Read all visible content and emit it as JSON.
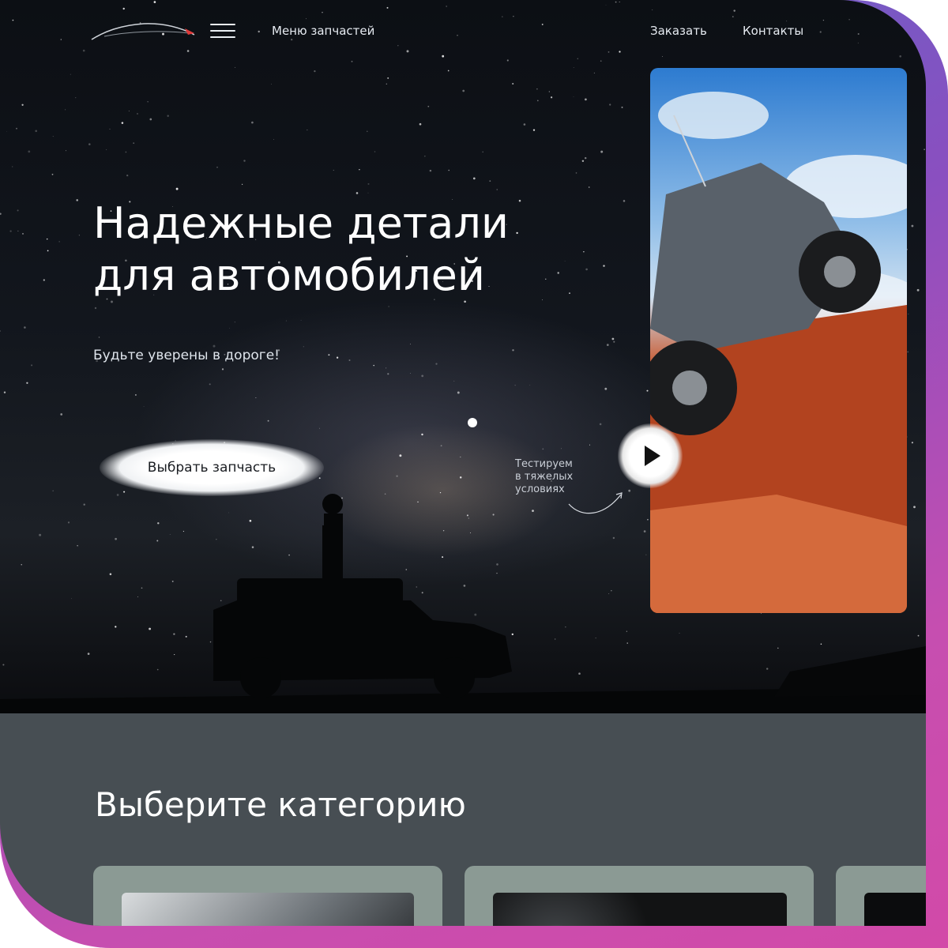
{
  "nav": {
    "menu_label": "Меню запчастей",
    "order_label": "Заказать",
    "contacts_label": "Контакты"
  },
  "hero": {
    "title_line1": "Надежные детали",
    "title_line2": "для автомобилей",
    "subtitle": "Будьте уверены в дороге!",
    "cta_label": "Выбрать запчасть",
    "note_line1": "Тестируем",
    "note_line2": "в тяжелых",
    "note_line3": "условиях"
  },
  "categories": {
    "title": "Выберите категорию"
  },
  "icons": {
    "logo": "car-logo-icon",
    "menu": "hamburger-menu-icon",
    "play": "play-icon",
    "arrow": "curved-arrow-icon"
  },
  "colors": {
    "accent_line": "#3b82d6",
    "section_bg": "#474e53",
    "card_bg": "#8b9a94",
    "frame_gradient_start": "#5b67c9",
    "frame_gradient_end": "#d24aa8"
  }
}
